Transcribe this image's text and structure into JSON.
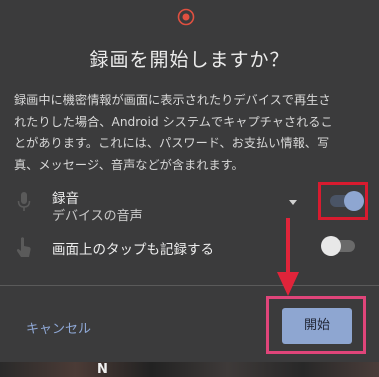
{
  "dialog": {
    "title": "録画を開始しますか？",
    "body_lines": [
      "録画中に機密情報が画面に表示されたりデバイスで再生さ",
      "れたりした場合、Android システムでキャプチャされるこ",
      "とがあります。これには、パスワード、お支払い情報、写",
      "真、メッセージ、音声などが含まれます。"
    ]
  },
  "options": {
    "audio": {
      "label": "録音",
      "sub": "デバイスの音声",
      "toggle_state": "on",
      "icon": "microphone-icon"
    },
    "taps": {
      "label": "画面上のタップも記録する",
      "toggle_state": "off",
      "icon": "touch-hand-icon"
    }
  },
  "buttons": {
    "cancel": "キャンセル",
    "start": "開始"
  },
  "colors": {
    "accent": "#8ea6d1",
    "highlight_red": "#d81b2f",
    "highlight_pink": "#e0457a",
    "dialog_bg": "#3b3b3c"
  },
  "bottom_strip": {
    "visible_glyph": "N"
  }
}
